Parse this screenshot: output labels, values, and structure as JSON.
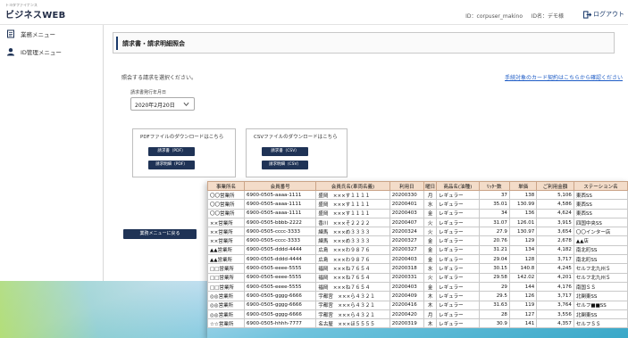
{
  "header": {
    "logo_sub": "トヨタファイナンス",
    "logo": "ビジネスWEB",
    "user_id": "ID：corpuser_makino",
    "user_name": "ID名：デモ様",
    "logout": "ログアウト"
  },
  "sidebar": {
    "items": [
      {
        "label": "業務メニュー",
        "icon": "document-icon"
      },
      {
        "label": "ID管理メニュー",
        "icon": "user-icon"
      }
    ]
  },
  "main": {
    "title": "請求書・請求明細照会",
    "prompt": "照会する請求を選択ください。",
    "card_link": "手続対象のカード契約はこちらから確認ください",
    "date_label": "請求書発行年月日",
    "date_value": "2020年2月20日",
    "pdf": {
      "title": "PDFファイルのダウンロードはこちら",
      "btn1": "請求書（PDF）",
      "btn2": "請求明細（PDF）"
    },
    "csv": {
      "title": "CSVファイルのダウンロードはこちら",
      "btn1": "請求書（CSV）",
      "btn2": "請求明細（CSV）"
    },
    "back": "業務メニューに戻る"
  },
  "table": {
    "headers": [
      "事業所名",
      "会員番号",
      "会員氏名(車両名義)",
      "利用日",
      "曜日",
      "商品名(油種)",
      "ﾘｯﾀｰ数",
      "単価",
      "ご利用金額",
      "ステーション名"
    ],
    "rows": [
      [
        "〇〇営業所",
        "6900-0505-aaaa-1111",
        "盛岡　×××す１１１１",
        "20200330",
        "月",
        "レギュラー",
        "37",
        "138",
        "5,106",
        "東西SS"
      ],
      [
        "〇〇営業所",
        "6900-0505-aaaa-1111",
        "盛岡　×××す１１１１",
        "20200401",
        "水",
        "レギュラー",
        "35.01",
        "130.99",
        "4,586",
        "東西SS"
      ],
      [
        "〇〇営業所",
        "6900-0505-aaaa-1111",
        "盛岡　×××す１１１１",
        "20200403",
        "金",
        "レギュラー",
        "34",
        "136",
        "4,624",
        "東西SS"
      ],
      [
        "××営業所",
        "6900-0505-bbbb-2222",
        "香川　×××そ２２２２",
        "20200407",
        "火",
        "レギュラー",
        "31.07",
        "126.01",
        "3,915",
        "四国中央SS"
      ],
      [
        "××営業所",
        "6900-0505-cccc-3333",
        "練馬　×××め３３３３",
        "20200324",
        "火",
        "レギュラー",
        "27.9",
        "130.97",
        "3,654",
        "〇〇インター店"
      ],
      [
        "××営業所",
        "6900-0505-cccc-3333",
        "練馬　×××め３３３３",
        "20200327",
        "金",
        "レギュラー",
        "20.76",
        "129",
        "2,678",
        "▲▲店"
      ],
      [
        "▲▲営業所",
        "6900-0505-dddd-4444",
        "広島　×××わ９８７６",
        "20200327",
        "金",
        "レギュラー",
        "31.21",
        "134",
        "4,182",
        "南北町SS"
      ],
      [
        "▲▲営業所",
        "6900-0505-dddd-4444",
        "広島　×××わ９８７６",
        "20200403",
        "金",
        "レギュラー",
        "29.04",
        "128",
        "3,717",
        "南北町SS"
      ],
      [
        "□□営業所",
        "6900-0505-eeee-5555",
        "福岡　×××ね７６５４",
        "20200318",
        "水",
        "レギュラー",
        "30.15",
        "140.8",
        "4,245",
        "セルフ北九州Ｓ"
      ],
      [
        "□□営業所",
        "6900-0505-eeee-5555",
        "福岡　×××ね７６５４",
        "20200331",
        "火",
        "レギュラー",
        "29.58",
        "142.02",
        "4,201",
        "セルフ北九州Ｓ"
      ],
      [
        "□□営業所",
        "6900-0505-eeee-5555",
        "福岡　×××ね７６５４",
        "20200403",
        "金",
        "レギュラー",
        "29",
        "144",
        "4,176",
        "南国ＳＳ"
      ],
      [
        "◎◎営業所",
        "6900-0505-gggg-6666",
        "宇都宮　×××ら４３２１",
        "20200409",
        "木",
        "レギュラー",
        "29.5",
        "126",
        "3,717",
        "北関東SS"
      ],
      [
        "◎◎営業所",
        "6900-0505-gggg-6666",
        "宇都宮　×××ら４３２１",
        "20200416",
        "木",
        "レギュラー",
        "31.63",
        "119",
        "3,764",
        "セルフ■■SS"
      ],
      [
        "◎◎営業所",
        "6900-0505-gggg-6666",
        "宇都宮　×××ら４３２１",
        "20200420",
        "月",
        "レギュラー",
        "28",
        "127",
        "3,556",
        "北関東SS"
      ],
      [
        "☆☆営業所",
        "6900-0505-hhhh-7777",
        "名古屋　×××ほ５５５５",
        "20200319",
        "木",
        "レギュラー",
        "30.9",
        "141",
        "4,357",
        "セルフＳＳ"
      ]
    ]
  },
  "colors": {
    "accent": "#1f3356",
    "link": "#1e5cc6",
    "table_header": "#f3dcc9"
  }
}
